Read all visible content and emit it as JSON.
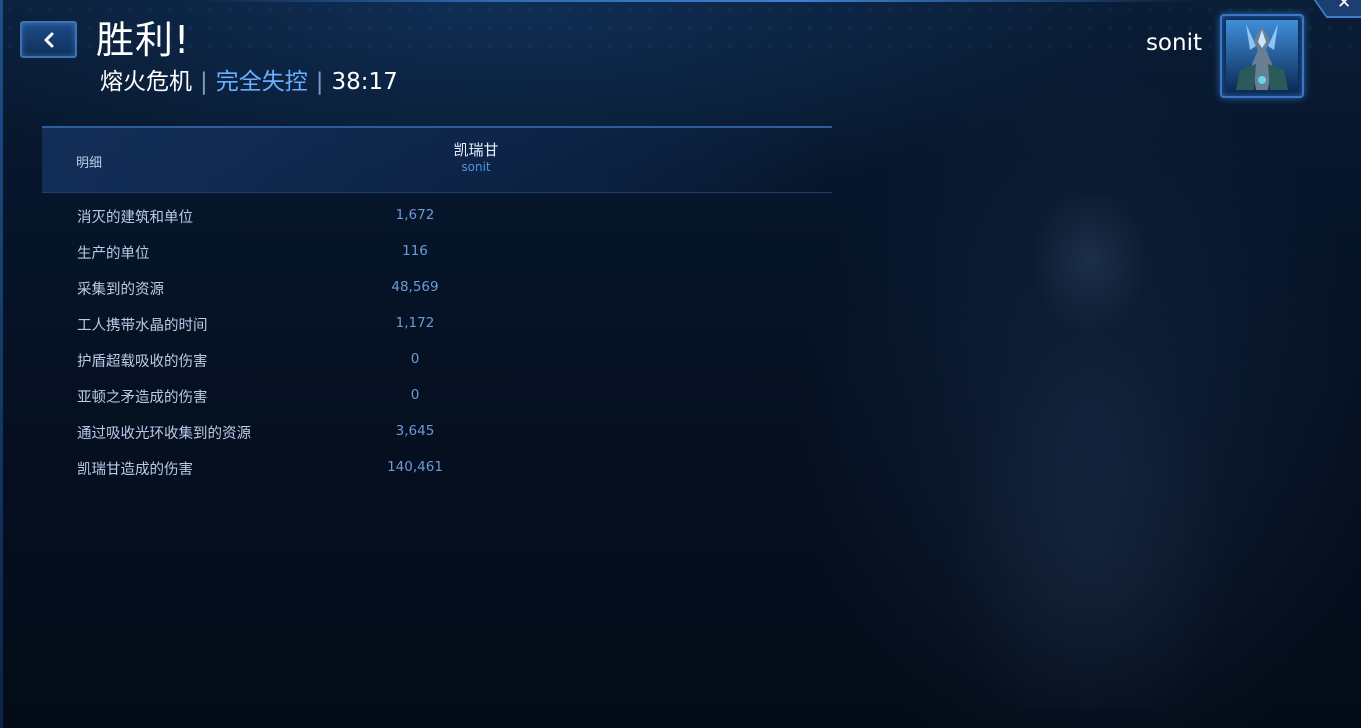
{
  "header": {
    "title": "胜利!",
    "map_name": "熔火危机",
    "separator": "|",
    "difficulty": "完全失控",
    "duration": "38:17"
  },
  "player": {
    "name": "sonit",
    "portrait_icon": "artanis-portrait-icon"
  },
  "table": {
    "detail_label": "明细",
    "commander_name": "凯瑞甘",
    "commander_player": "sonit",
    "rows": [
      {
        "label": "消灭的建筑和单位",
        "value": "1,672"
      },
      {
        "label": "生产的单位",
        "value": "116"
      },
      {
        "label": "采集到的资源",
        "value": "48,569"
      },
      {
        "label": "工人携带水晶的时间",
        "value": "1,172"
      },
      {
        "label": "护盾超载吸收的伤害",
        "value": "0"
      },
      {
        "label": "亚顿之矛造成的伤害",
        "value": "0"
      },
      {
        "label": "通过吸收光环收集到的资源",
        "value": "3,645"
      },
      {
        "label": "凯瑞甘造成的伤害",
        "value": "140,461"
      }
    ]
  },
  "colors": {
    "accent": "#6ab0ff",
    "value_text": "#6d9ad6",
    "background": "#04101f"
  }
}
